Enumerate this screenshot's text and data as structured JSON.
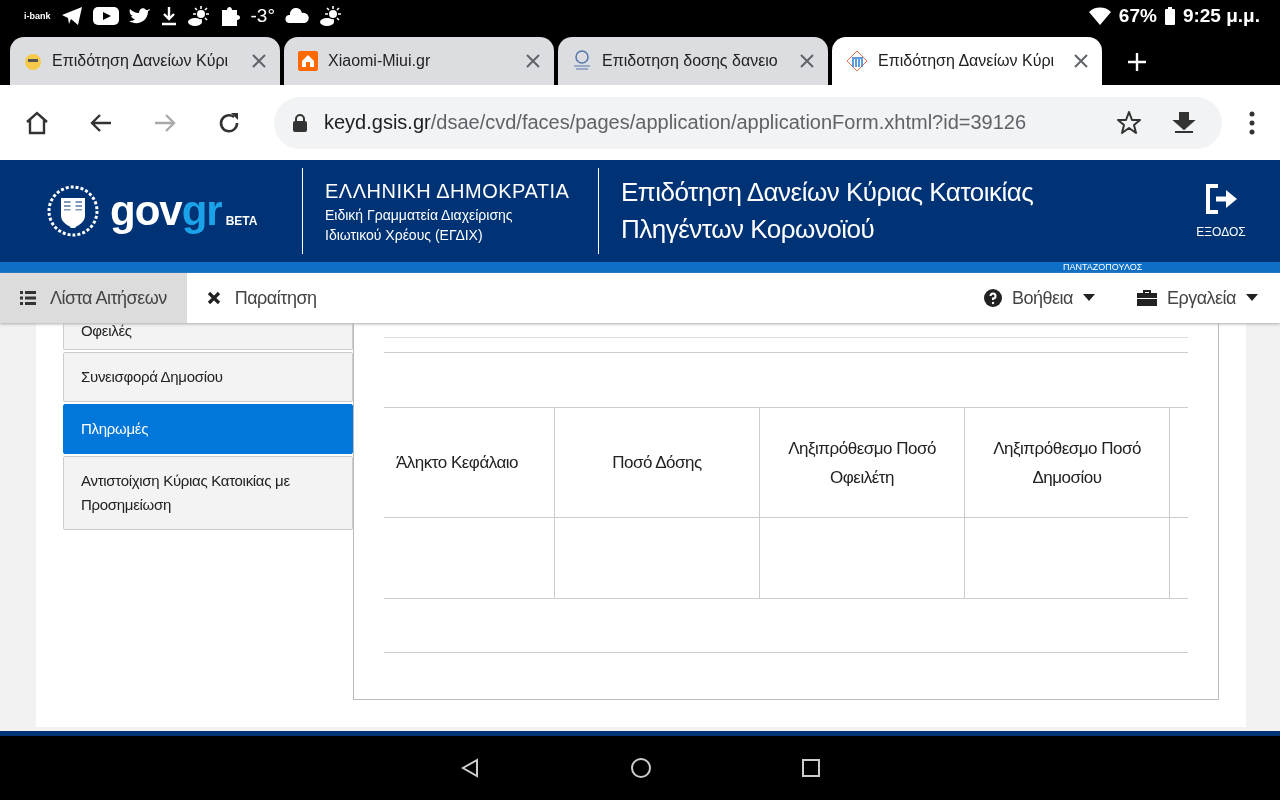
{
  "status_bar": {
    "app_label": "i-bank",
    "temperature": "-3°",
    "battery": "67%",
    "time": "9:25 μ.μ."
  },
  "browser_tabs": [
    {
      "title": "Επιδότηση Δανείων Κύρι",
      "selected": false
    },
    {
      "title": "Xiaomi-Miui.gr",
      "selected": false
    },
    {
      "title": "Επιδοτηση δοσης δανειο",
      "selected": false
    },
    {
      "title": "Επιδότηση Δανείων Κύρι",
      "selected": true
    }
  ],
  "address_bar": {
    "domain": "keyd.gsis.gr",
    "path": "/dsae/cvd/faces/pages/application/applicationForm.xhtml?id=39126"
  },
  "header": {
    "logo": "gov",
    "logo_accent": "gr",
    "logo_badge": "BETA",
    "org_title": "ΕΛΛΗΝΙΚΗ ΔΗΜΟΚΡΑΤΙΑ",
    "org_subtitle_lines": [
      "Ειδική Γραμματεία Διαχείρισης",
      "Ιδιωτικού Χρέους (ΕΓΔΙΧ)"
    ],
    "app_title_lines": [
      "Επιδότηση Δανείων Κύριας Κατοικίας",
      "Πληγέντων Κορωνοϊού"
    ],
    "exit_label": "ΕΞΟΔΟΣ",
    "user_name": "ΠΑΝΤΑΖΟΠΟΥΛΟΣ"
  },
  "toolbar": {
    "left": [
      {
        "label": "Λίστα Αιτήσεων",
        "selected": true
      },
      {
        "label": "Παραίτηση",
        "selected": false
      }
    ],
    "right": [
      {
        "label": "Βοήθεια"
      },
      {
        "label": "Εργαλεία"
      }
    ]
  },
  "sidebar": {
    "items": [
      {
        "label": "Οφειλές",
        "selected": false
      },
      {
        "label": "Συνεισφορά Δημοσίου",
        "selected": false
      },
      {
        "label": "Πληρωμές",
        "selected": true
      },
      {
        "label": "Αντιστοίχιση Κύριας Κατοικίας με Προσημείωση",
        "selected": false
      }
    ]
  },
  "table": {
    "columns": [
      "Άληκτο Κεφάλαιο",
      "Ποσό Δόσης",
      "Ληξιπρόθεσμο Ποσό Οφειλέτη",
      "Ληξιπρόθεσμο Ποσό Δημοσίου"
    ]
  }
}
